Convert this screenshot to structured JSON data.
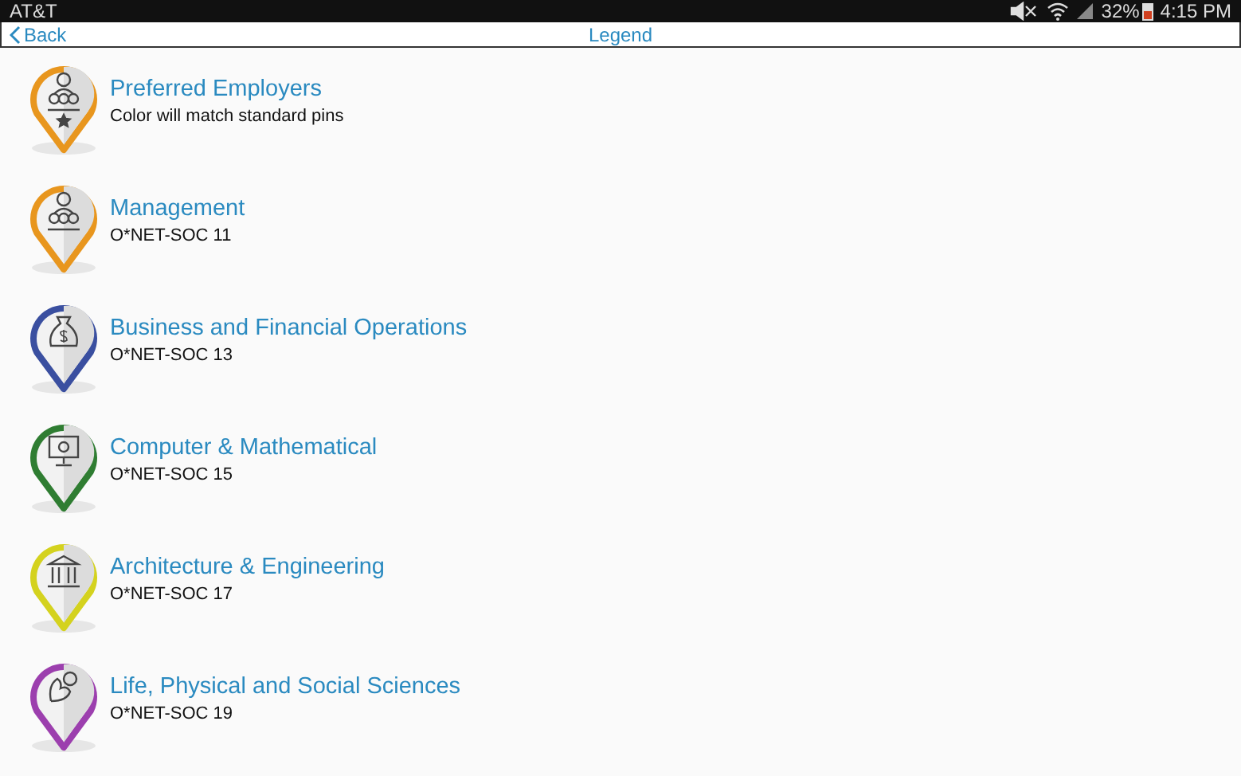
{
  "status_bar": {
    "carrier": "AT&T",
    "battery": "32%",
    "time": "4:15 PM"
  },
  "nav_bar": {
    "back": "Back",
    "title": "Legend"
  },
  "legend_items": [
    {
      "title": "Preferred Employers",
      "subtitle": "Color will match standard pins",
      "color": "#e8961e",
      "kind": "employers"
    },
    {
      "title": "Management",
      "subtitle": "O*NET-SOC 11",
      "color": "#e8961e",
      "kind": "people"
    },
    {
      "title": "Business and Financial Operations",
      "subtitle": "O*NET-SOC 13",
      "color": "#3a4fa0",
      "kind": "moneybag"
    },
    {
      "title": "Computer & Mathematical",
      "subtitle": "O*NET-SOC 15",
      "color": "#2f7d32",
      "kind": "monitor"
    },
    {
      "title": "Architecture & Engineering",
      "subtitle": "O*NET-SOC 17",
      "color": "#d4d21e",
      "kind": "columns"
    },
    {
      "title": "Life, Physical and Social Sciences",
      "subtitle": "O*NET-SOC 19",
      "color": "#9c3fae",
      "kind": "flexing"
    }
  ]
}
